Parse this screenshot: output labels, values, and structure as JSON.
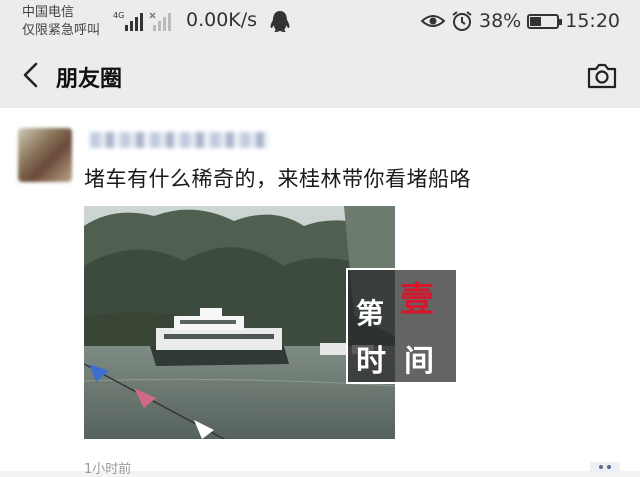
{
  "status_bar": {
    "carrier": "中国电信",
    "emergency": "仅限紧急呼叫",
    "network": "4G",
    "speed": "0.00K/s",
    "battery_percent": "38%",
    "battery_level": 0.38,
    "time": "15:20"
  },
  "header": {
    "title": "朋友圈",
    "back_icon": "chevron-left-icon",
    "camera_icon": "camera-icon"
  },
  "post": {
    "text": "堵车有什么稀奇的，来桂林带你看堵船咯",
    "timestamp": "1小时前",
    "photo": "river-boats-karst-photo"
  },
  "watermark": {
    "lettering": [
      "第",
      "壹",
      "时",
      "间"
    ],
    "brand_color": "#d6162a"
  },
  "colors": {
    "header_bg": "#ececec",
    "post_bg": "#ffffff"
  }
}
